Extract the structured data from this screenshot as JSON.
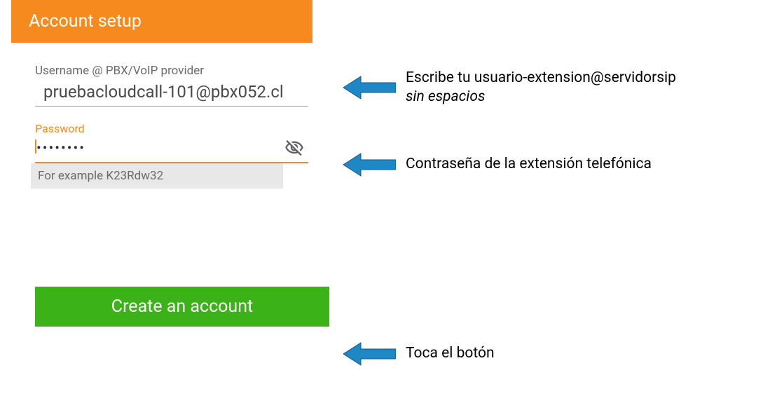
{
  "header": {
    "title": "Account setup"
  },
  "fields": {
    "username": {
      "label": "Username @ PBX/VoIP provider",
      "value": "pruebacloudcall-101@pbx052.cl"
    },
    "password": {
      "label": "Password",
      "value": "••••••••",
      "hint": "For example K23Rdw32"
    }
  },
  "button": {
    "create_label": "Create an account"
  },
  "annotations": {
    "a1_line1": "Escribe tu usuario-extension@servidorsip",
    "a1_line2": "sin espacios",
    "a2": "Contraseña de la extensión telefónica",
    "a3": "Toca el botón"
  }
}
